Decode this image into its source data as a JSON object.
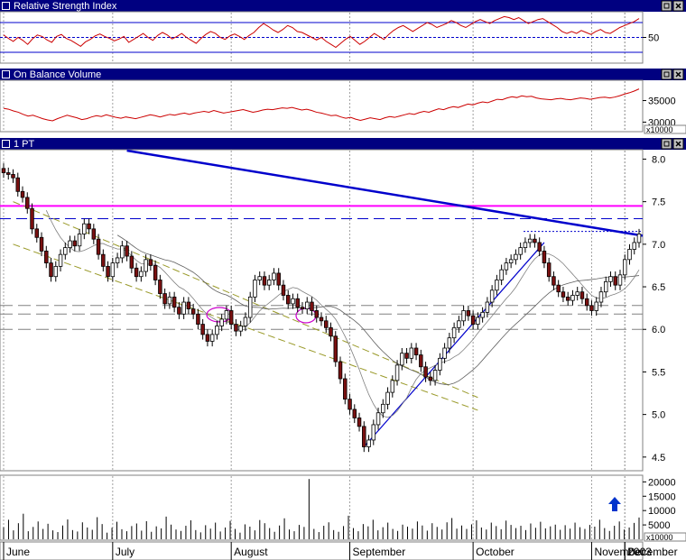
{
  "chart_data": {
    "type": "candlestick",
    "panels": {
      "rsi": {
        "title": "Relative Strength Index",
        "ylim": [
          0,
          100
        ],
        "ticks": [
          {
            "v": 50,
            "label": "50"
          }
        ],
        "levels": {
          "upper": 80,
          "mid": 50,
          "lower": 20
        },
        "values": [
          55,
          48,
          42,
          50,
          44,
          36,
          47,
          55,
          52,
          45,
          40,
          52,
          56,
          48,
          44,
          38,
          32,
          41,
          46,
          53,
          57,
          52,
          48,
          43,
          47,
          52,
          40,
          46,
          52,
          58,
          50,
          44,
          54,
          60,
          55,
          47,
          52,
          58,
          50,
          44,
          38,
          48,
          56,
          62,
          58,
          50,
          46,
          53,
          57,
          52,
          46,
          54,
          60,
          70,
          78,
          72,
          65,
          60,
          66,
          74,
          70,
          62,
          60,
          55,
          50,
          45,
          50,
          42,
          36,
          30,
          38,
          46,
          52,
          44,
          36,
          42,
          50,
          58,
          52,
          46,
          56,
          64,
          70,
          74,
          68,
          62,
          68,
          74,
          80,
          76,
          70,
          74,
          78,
          84,
          80,
          74,
          70,
          76,
          82,
          86,
          82,
          78,
          84,
          88,
          92,
          90,
          86,
          90,
          84,
          78,
          82,
          86,
          88,
          82,
          76,
          70,
          62,
          58,
          62,
          58,
          64,
          60,
          56,
          62,
          66,
          60,
          58,
          64,
          70,
          74,
          78,
          82,
          88
        ]
      },
      "obv": {
        "title": "On Balance Volume",
        "ylim": [
          28000,
          39500
        ],
        "ticks": [
          {
            "v": 35000,
            "label": "35000"
          },
          {
            "v": 30000,
            "label": "30000"
          }
        ],
        "unit_label": "x10000",
        "values": [
          33200,
          33000,
          32600,
          32300,
          31800,
          31400,
          31600,
          31200,
          30800,
          30500,
          30300,
          30800,
          31200,
          31600,
          31300,
          31000,
          30600,
          30800,
          31200,
          31500,
          31300,
          31700,
          31400,
          31100,
          30900,
          31200,
          31000,
          30800,
          31100,
          31400,
          31700,
          31500,
          31200,
          31500,
          31800,
          31600,
          31900,
          32100,
          31800,
          32100,
          32300,
          32500,
          32300,
          32700,
          32400,
          32100,
          32300,
          32500,
          32700,
          32900,
          32600,
          32300,
          32500,
          32800,
          33000,
          32900,
          33100,
          33300,
          33200,
          33400,
          33100,
          32800,
          33000,
          32700,
          32300,
          32100,
          31800,
          31500,
          31600,
          31200,
          30900,
          31100,
          30700,
          30400,
          30700,
          31000,
          30800,
          30600,
          31000,
          31300,
          31100,
          31400,
          31700,
          32000,
          31800,
          32200,
          32500,
          32300,
          32700,
          33100,
          32900,
          33300,
          33600,
          33400,
          33800,
          34200,
          34000,
          34400,
          34700,
          34500,
          34900,
          35300,
          35200,
          35600,
          35900,
          35700,
          36100,
          35900,
          36000,
          35600,
          35400,
          35300,
          35200,
          35400,
          35500,
          35300,
          35200,
          35400,
          35600,
          35500,
          35300,
          35500,
          35700,
          35800,
          35600,
          35800,
          36100,
          36500,
          36800,
          37200,
          37700
        ]
      },
      "price": {
        "title": "1 PT",
        "ylim": [
          4.35,
          8.1
        ],
        "ticks": [
          {
            "v": 8.0,
            "label": "8.0"
          },
          {
            "v": 7.5,
            "label": "7.5"
          },
          {
            "v": 7.0,
            "label": "7.0"
          },
          {
            "v": 6.5,
            "label": "6.5"
          },
          {
            "v": 6.0,
            "label": "6.0"
          },
          {
            "v": 5.5,
            "label": "5.5"
          },
          {
            "v": 5.0,
            "label": "5.0"
          },
          {
            "v": 4.5,
            "label": "4.5"
          }
        ],
        "closes": [
          7.84,
          7.82,
          7.78,
          7.62,
          7.55,
          7.42,
          7.18,
          7.08,
          6.92,
          6.78,
          6.62,
          6.74,
          6.88,
          6.96,
          7.04,
          6.98,
          7.12,
          7.24,
          7.18,
          7.06,
          6.88,
          6.74,
          6.62,
          6.78,
          6.84,
          6.98,
          6.86,
          6.72,
          6.62,
          6.68,
          6.82,
          6.75,
          6.58,
          6.42,
          6.3,
          6.38,
          6.26,
          6.18,
          6.32,
          6.24,
          6.18,
          6.06,
          5.94,
          5.86,
          5.94,
          6.04,
          6.12,
          6.22,
          6.06,
          5.98,
          6.04,
          6.14,
          6.38,
          6.58,
          6.62,
          6.52,
          6.58,
          6.66,
          6.52,
          6.4,
          6.3,
          6.36,
          6.26,
          6.24,
          6.32,
          6.22,
          6.14,
          6.1,
          6.02,
          5.92,
          5.62,
          5.42,
          5.18,
          5.06,
          4.96,
          4.86,
          4.62,
          4.7,
          4.88,
          5.02,
          5.12,
          5.26,
          5.4,
          5.58,
          5.72,
          5.66,
          5.78,
          5.7,
          5.56,
          5.44,
          5.4,
          5.52,
          5.66,
          5.78,
          5.9,
          6.02,
          6.1,
          6.22,
          6.16,
          6.06,
          6.14,
          6.2,
          6.32,
          6.46,
          6.58,
          6.7,
          6.78,
          6.82,
          6.88,
          6.96,
          7.02,
          7.06,
          7.02,
          6.92,
          6.78,
          6.62,
          6.52,
          6.44,
          6.38,
          6.34,
          6.4,
          6.44,
          6.36,
          6.28,
          6.22,
          6.32,
          6.44,
          6.56,
          6.62,
          6.52,
          6.64,
          6.82,
          6.94,
          7.02,
          7.12
        ],
        "highlight_close_index": 76,
        "resistance": [
          7.45,
          7.3,
          7.15
        ],
        "support": [
          6.28,
          6.18,
          6.0
        ],
        "downtrend_line": {
          "from": [
            26,
            8.1
          ],
          "to": [
            148,
            7.1
          ]
        },
        "uptrend_line": {
          "from": [
            76,
            4.62
          ],
          "to": [
            114,
            7.02
          ]
        },
        "upper_channel": {
          "from": [
            2,
            7.5
          ],
          "to": [
            100,
            5.2
          ]
        },
        "lower_channel": {
          "from": [
            2,
            7.0
          ],
          "to": [
            100,
            5.05
          ]
        }
      },
      "volume": {
        "ylim": [
          0,
          22000
        ],
        "ticks": [
          {
            "v": 20000,
            "label": "20000"
          },
          {
            "v": 15000,
            "label": "15000"
          },
          {
            "v": 10000,
            "label": "10000"
          },
          {
            "v": 5000,
            "label": "5000"
          }
        ],
        "unit_label": "x10000",
        "values": [
          4200,
          6800,
          3100,
          5600,
          8900,
          2800,
          4300,
          6200,
          3600,
          5400,
          3100,
          2500,
          4800,
          6900,
          3200,
          2700,
          5900,
          4100,
          3300,
          7700,
          5300,
          2300,
          4000,
          6100,
          3500,
          2800,
          4600,
          5500,
          3000,
          6300,
          2600,
          4500,
          3800,
          7900,
          5100,
          3400,
          2900,
          4700,
          6600,
          3200,
          2400,
          4900,
          3700,
          5800,
          2700,
          4100,
          6400,
          3600,
          2300,
          5200,
          4400,
          3100,
          6700,
          5600,
          3900,
          2600,
          4800,
          7300,
          3400,
          2800,
          5000,
          4300,
          21000,
          3600,
          2500,
          4700,
          5900,
          3200,
          2600,
          4600,
          8200,
          3900,
          2800,
          5300,
          4500,
          6800,
          3100,
          4200,
          5800,
          3600,
          2900,
          5100,
          4400,
          3700,
          6200,
          4800,
          3000,
          5600,
          4300,
          3400,
          5900,
          7400,
          3700,
          4800,
          3600,
          5200,
          6600,
          4100,
          3400,
          5800,
          4600,
          3500,
          6500,
          5000,
          3900,
          4700,
          3200,
          5500,
          4000,
          6100,
          3800,
          4500,
          5100,
          3300,
          4900,
          3700,
          5800,
          4200,
          3600,
          5000,
          4400,
          6800,
          3900,
          2900,
          4700,
          6200,
          3400,
          4100,
          5700,
          7600
        ]
      }
    },
    "x_labels": [
      "June",
      "July",
      "August",
      "September",
      "October",
      "November",
      "December",
      "2003"
    ],
    "x_label_index": [
      3,
      26,
      51,
      76,
      102,
      127,
      151,
      170
    ],
    "n_bars": 135
  },
  "icons": {
    "restore": "restore-icon",
    "close": "close-icon",
    "arrow": "up-arrow-icon"
  },
  "colors": {
    "up_candle": "#ffffff",
    "down_candle": "#7a1010",
    "rsi_line": "#cc0000",
    "obv_line": "#cc0000",
    "resistance_main": "#ff00ff",
    "trend_blue": "#0000cc",
    "channel": "#9a9a2a",
    "highlight": "#cc00cc",
    "title_bar": "#000080",
    "title_text": "#ffffff"
  }
}
